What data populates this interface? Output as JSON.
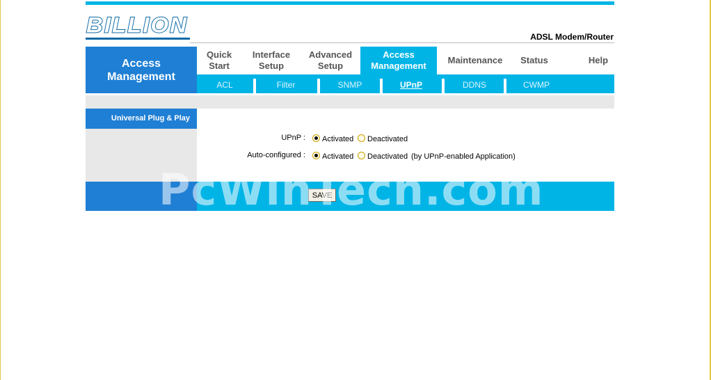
{
  "brand": {
    "logo_text": "BILLION",
    "product": "ADSL Modem/Router"
  },
  "section_title": {
    "line1": "Access",
    "line2": "Management"
  },
  "main_nav": [
    {
      "line1": "Quick",
      "line2": "Start"
    },
    {
      "line1": "Interface",
      "line2": "Setup"
    },
    {
      "line1": "Advanced",
      "line2": "Setup"
    },
    {
      "line1": "Access",
      "line2": "Management"
    },
    {
      "line1": "Maintenance",
      "line2": ""
    },
    {
      "line1": "Status",
      "line2": ""
    },
    {
      "line1": "Help",
      "line2": ""
    }
  ],
  "sub_nav": [
    "ACL",
    "Filter",
    "SNMP",
    "UPnP",
    "DDNS",
    "CWMP"
  ],
  "left_tab": "Universal Plug & Play",
  "form": {
    "upnp": {
      "label": "UPnP :",
      "opt1": "Activated",
      "opt2": "Deactivated",
      "selected": "Activated"
    },
    "auto": {
      "label": "Auto-configured :",
      "opt1": "Activated",
      "opt2": "Deactivated",
      "note": "(by UPnP-enabled Application)",
      "selected": "Activated"
    }
  },
  "save_label": "SAVE",
  "watermark": "PcWinTech.com",
  "colors": {
    "accent": "#00b4e6",
    "section_blue": "#1f7fd4",
    "gray": "#e8e8e8"
  }
}
